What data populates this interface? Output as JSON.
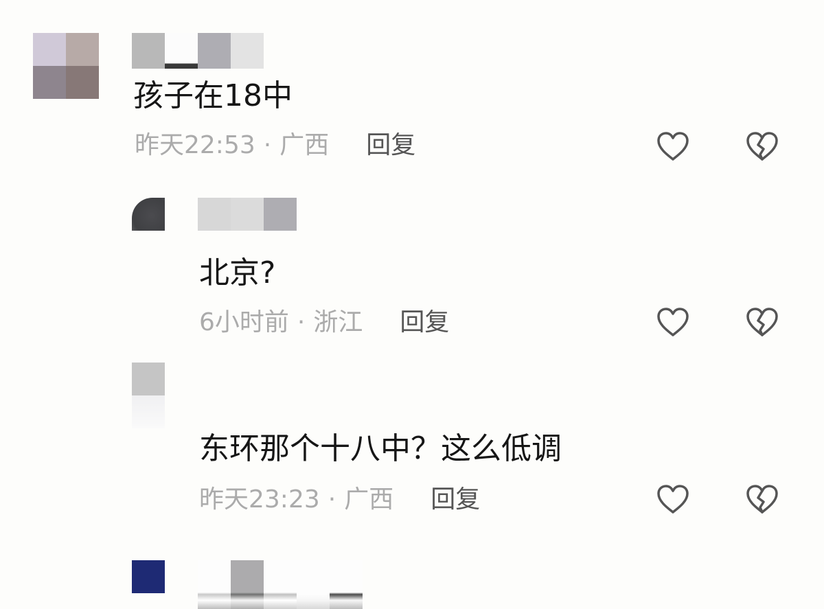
{
  "comments": [
    {
      "text": "孩子在18中",
      "time": "昨天22:53",
      "separator": "·",
      "location": "广西",
      "reply_label": "回复"
    },
    {
      "text": "北京?",
      "time": "6小时前",
      "separator": "·",
      "location": "浙江",
      "reply_label": "回复"
    },
    {
      "text": "东环那个十八中？这么低调",
      "time": "昨天23:23",
      "separator": "·",
      "location": "广西",
      "reply_label": "回复"
    },
    {
      "text": "",
      "time": "",
      "separator": "",
      "location": "",
      "reply_label": ""
    }
  ],
  "icons": {
    "like": "heart-outline-icon",
    "dislike": "broken-heart-icon"
  },
  "colors": {
    "background": "#fdfdfb",
    "text": "#161616",
    "meta": "#ababab",
    "reply": "#555555",
    "icon": "#555555",
    "avatar_navy": "#1e2a74"
  }
}
